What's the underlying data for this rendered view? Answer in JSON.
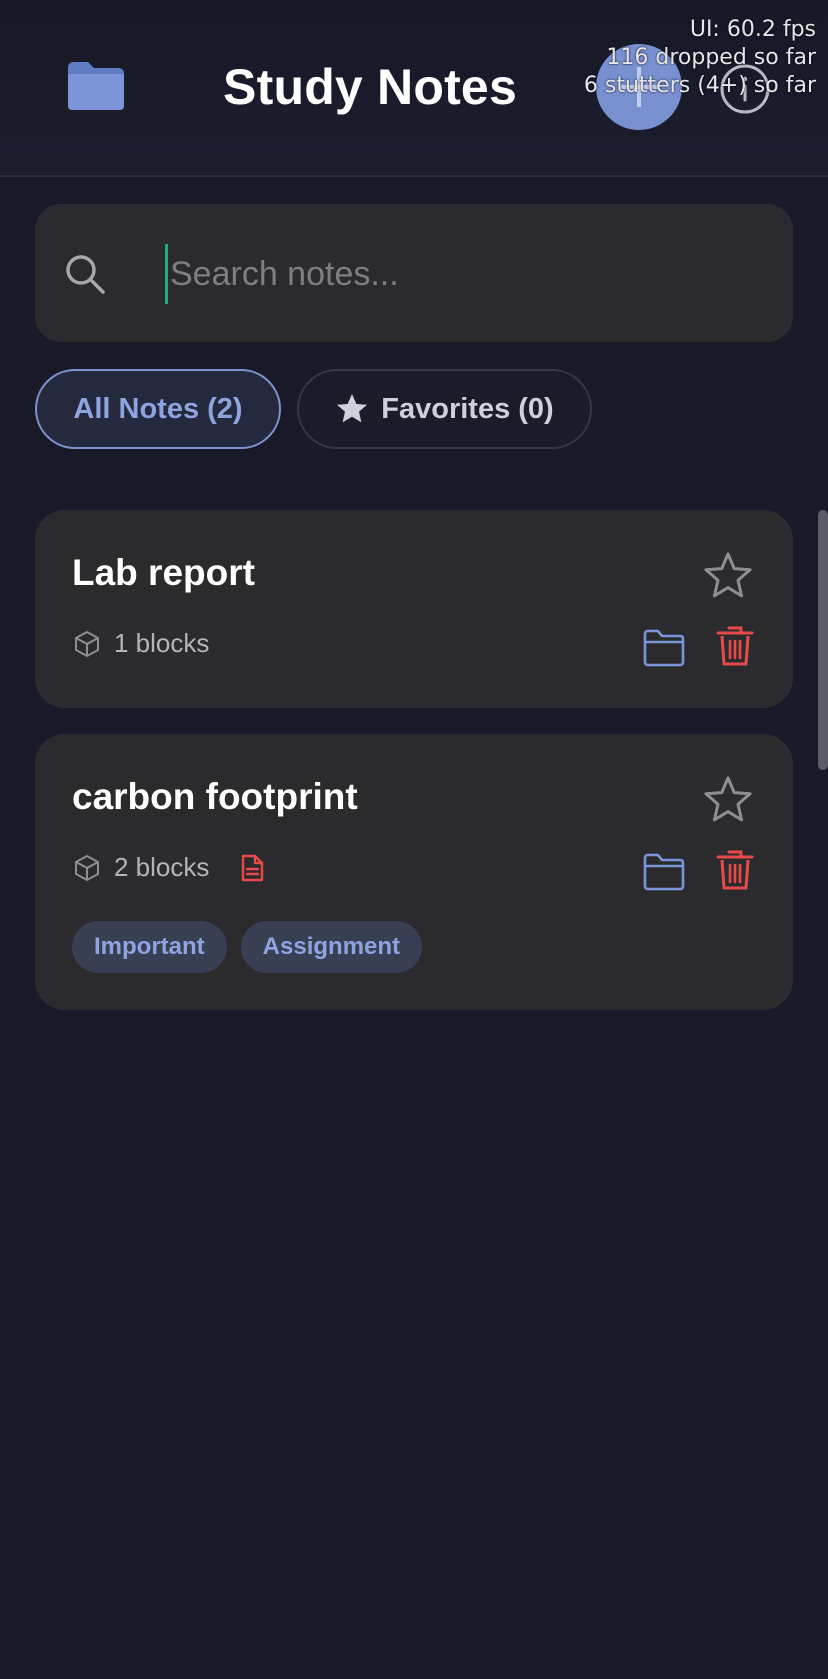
{
  "header": {
    "title": "Study Notes",
    "icons": {
      "folder": "folder-icon",
      "add": "plus-icon",
      "info": "info-icon"
    }
  },
  "perf_overlay": {
    "fps": "UI: 60.2 fps",
    "dropped": "116 dropped so far",
    "stutters": "6 stutters (4+) so far"
  },
  "search": {
    "placeholder": "Search notes...",
    "value": ""
  },
  "filters": {
    "all_label": "All Notes (2)",
    "favorites_label": "Favorites (0)",
    "active": "all"
  },
  "notes": [
    {
      "title": "Lab report",
      "blocks_label": "1 blocks",
      "has_document": false,
      "tags": []
    },
    {
      "title": "carbon footprint",
      "blocks_label": "2 blocks",
      "has_document": true,
      "tags": [
        "Important",
        "Assignment"
      ]
    }
  ],
  "colors": {
    "background": "#181a29",
    "card": "#2b2b2e",
    "accent": "#8ea4e0",
    "danger": "#e84a4a",
    "cursor": "#1fa88a"
  }
}
